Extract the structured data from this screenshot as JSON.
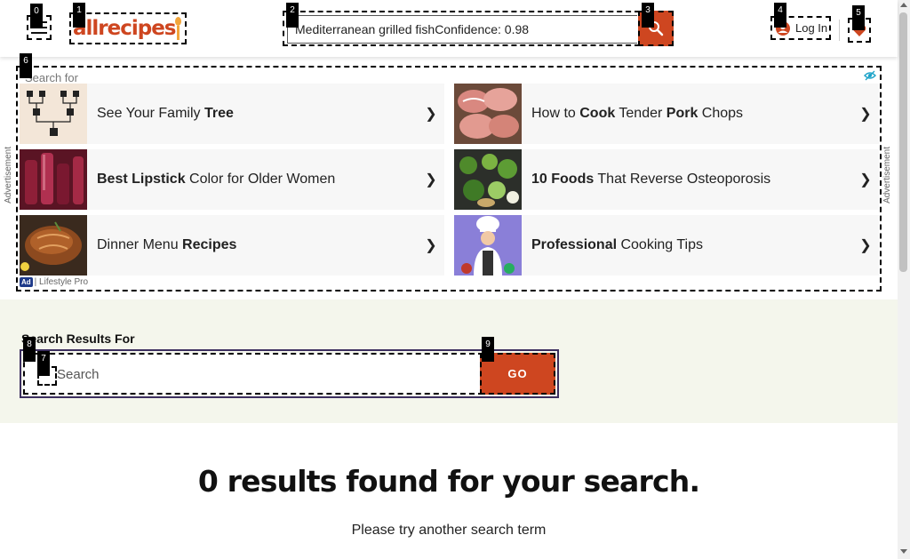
{
  "header": {
    "logo_text": "allrecipes",
    "search_value": "Mediterranean grilled fishConfidence: 0.98",
    "login_label": "Log In",
    "brand_color": "#ce4620"
  },
  "ad": {
    "search_for": "Search for",
    "side_label": "Advertisement",
    "footer_badge": "Ad",
    "footer_text": "| Lifestyle Pro",
    "items": [
      {
        "pre": "See Your Family ",
        "bold": "Tree",
        "post": ""
      },
      {
        "pre": "How to ",
        "bold": "Cook",
        "post": " Tender ",
        "bold2": "Pork",
        "post2": " Chops"
      },
      {
        "pre": "",
        "bold": "Best Lipstick",
        "post": " Color for Older Women"
      },
      {
        "pre": "",
        "bold": "10 Foods",
        "post": " That Reverse Osteoporosis"
      },
      {
        "pre": "Dinner Menu ",
        "bold": "Recipes",
        "post": ""
      },
      {
        "pre": "",
        "bold": "Professional",
        "post": " Cooking Tips"
      }
    ],
    "chevron": "❯"
  },
  "results": {
    "label": "Search Results For",
    "placeholder": "Search",
    "go_label": "GO",
    "title": "0 results found for your search.",
    "subtitle": "Please try another search term"
  },
  "markers": [
    "0",
    "1",
    "2",
    "3",
    "4",
    "5",
    "6",
    "7",
    "8",
    "9"
  ],
  "icons": {
    "menu": "hamburger-icon",
    "search": "search-icon",
    "user": "user-icon",
    "heart": "heart-icon",
    "adchoices": "eye-icon"
  }
}
